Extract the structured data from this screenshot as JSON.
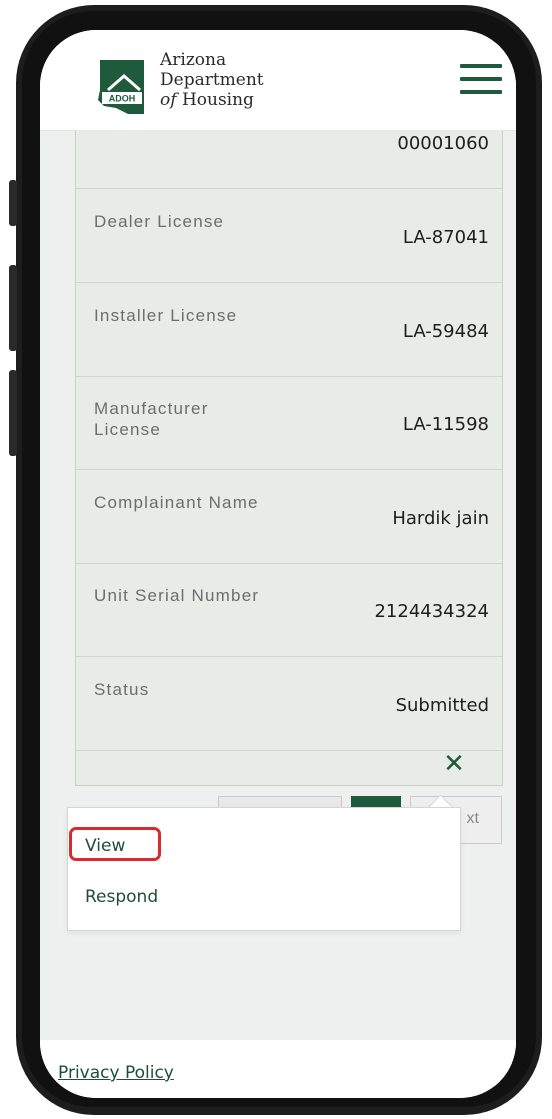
{
  "header": {
    "logo_line1": "Arizona",
    "logo_line2": "Department",
    "logo_line3_italic": "of",
    "logo_line3_rest": "Housing",
    "logo_badge": "ADOH",
    "menu_icon": "hamburger-menu-icon"
  },
  "table": {
    "partial_value": "00001060",
    "rows": [
      {
        "label": "Dealer License",
        "value": "LA-87041"
      },
      {
        "label": "Installer License",
        "value": "LA-59484"
      },
      {
        "label": "Manufacturer License",
        "value": "LA-11598"
      },
      {
        "label": "Complainant Name",
        "value": "Hardik jain"
      },
      {
        "label": "Unit Serial Number",
        "value": "2124434324"
      },
      {
        "label": "Status",
        "value": "Submitted"
      }
    ],
    "close_icon": "close-icon"
  },
  "pagination": {
    "next_partial": "xt"
  },
  "action_menu": {
    "items": [
      {
        "label": "View"
      },
      {
        "label": "Respond"
      }
    ],
    "highlight_color": "#d92b2b"
  },
  "footer": {
    "privacy_link": "Privacy Policy"
  },
  "colors": {
    "brand_green": "#1f5a3c",
    "card_bg": "#e7ece6"
  }
}
